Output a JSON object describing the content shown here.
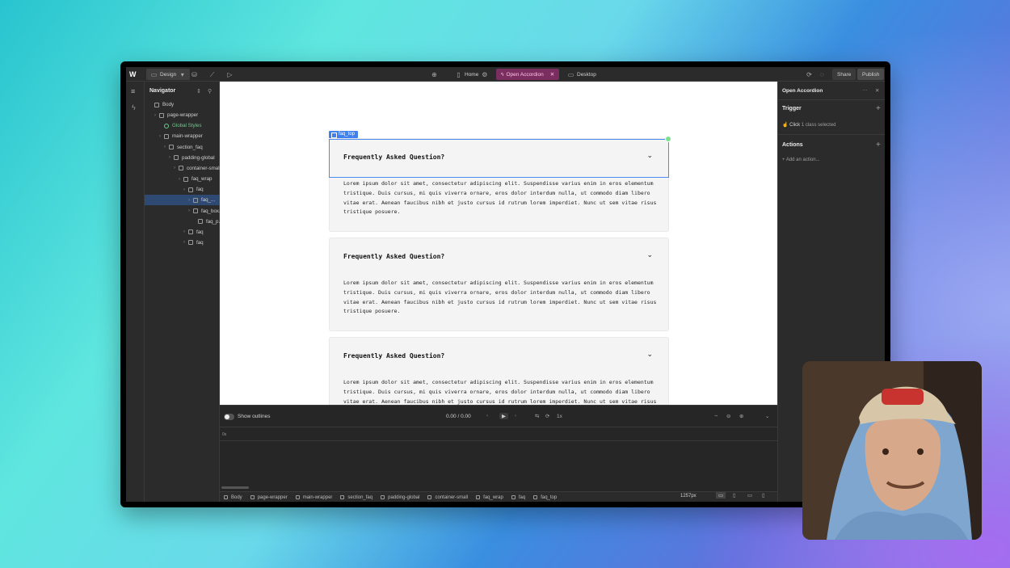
{
  "topbar": {
    "design_label": "Design",
    "page_label": "Home",
    "interaction_label": "Open Accordion",
    "breakpoint_label": "Desktop",
    "share_label": "Share",
    "publish_label": "Publish"
  },
  "navigator": {
    "title": "Navigator",
    "items": [
      {
        "label": "Body",
        "depth": 0
      },
      {
        "label": "page-wrapper",
        "depth": 1
      },
      {
        "label": "Global Styles",
        "depth": 2
      },
      {
        "label": "main-wrapper",
        "depth": 2
      },
      {
        "label": "section_faq",
        "depth": 3
      },
      {
        "label": "padding-global",
        "depth": 4
      },
      {
        "label": "container-small",
        "depth": 5
      },
      {
        "label": "faq_wrap",
        "depth": 6
      },
      {
        "label": "faq",
        "depth": 7
      },
      {
        "label": "faq_...",
        "depth": 8
      },
      {
        "label": "faq_box...",
        "depth": 8
      },
      {
        "label": "faq_p...",
        "depth": 9
      },
      {
        "label": "faq",
        "depth": 7
      },
      {
        "label": "faq",
        "depth": 7
      }
    ]
  },
  "canvas": {
    "selected_tag": "faq_top",
    "faqs": [
      {
        "question": "Frequently Asked Question?",
        "answer": "Lorem ipsum dolor sit amet, consectetur adipiscing elit. Suspendisse varius enim in eros elementum tristique. Duis cursus, mi quis viverra ornare, eros dolor interdum nulla, ut commodo diam libero vitae erat. Aenean faucibus nibh et justo cursus id rutrum lorem imperdiet. Nunc ut sem vitae risus tristique posuere."
      },
      {
        "question": "Frequently Asked Question?",
        "answer": "Lorem ipsum dolor sit amet, consectetur adipiscing elit. Suspendisse varius enim in eros elementum tristique. Duis cursus, mi quis viverra ornare, eros dolor interdum nulla, ut commodo diam libero vitae erat. Aenean faucibus nibh et justo cursus id rutrum lorem imperdiet. Nunc ut sem vitae risus tristique posuere."
      },
      {
        "question": "Frequently Asked Question?",
        "answer": "Lorem ipsum dolor sit amet, consectetur adipiscing elit. Suspendisse varius enim in eros elementum tristique. Duis cursus, mi quis viverra ornare, eros dolor interdum nulla, ut commodo diam libero vitae erat. Aenean faucibus nibh et justo cursus id rutrum lorem imperdiet. Nunc ut sem vitae risus tristique posuere."
      }
    ]
  },
  "interactions_panel": {
    "title": "Open Accordion",
    "trigger_heading": "Trigger",
    "trigger_text": "Click",
    "trigger_detail": "1 class selected",
    "actions_heading": "Actions",
    "add_action_label": "+ Add an action..."
  },
  "timeline": {
    "show_outlines_label": "Show outlines",
    "time_display": "0.00 / 0.00",
    "speed_label": "1x",
    "ruler_start": "0s"
  },
  "breadcrumbs": [
    "Body",
    "page-wrapper",
    "main-wrapper",
    "section_faq",
    "padding-global",
    "container-small",
    "faq_wrap",
    "faq",
    "faq_top"
  ],
  "statusbar": {
    "width_readout": "1257px"
  },
  "colors": {
    "accent": "#3f82ef",
    "interaction_pill": "#7a2d5f",
    "global_styles": "#6ec98b"
  }
}
